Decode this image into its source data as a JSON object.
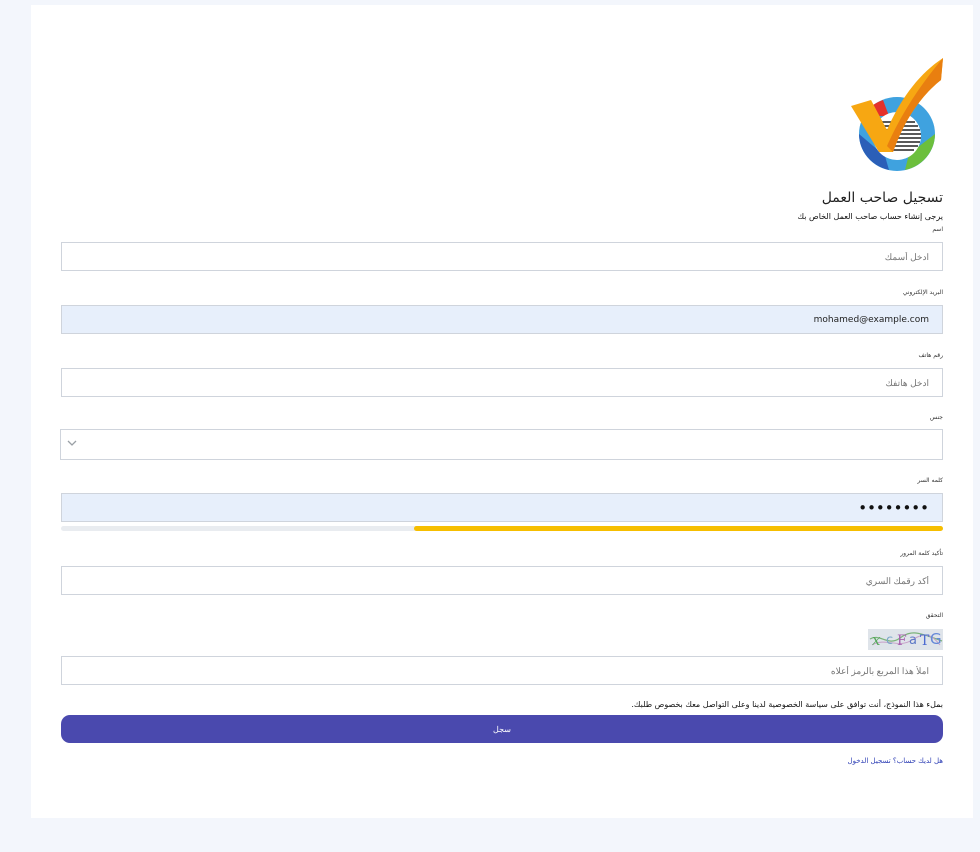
{
  "header": {
    "title": "تسجيل صاحب العمل",
    "subtitle": "يرجى إنشاء حساب صاحب العمل الخاص بك"
  },
  "fields": {
    "name": {
      "label": "اسم",
      "placeholder": "ادخل أسمك",
      "value": ""
    },
    "email": {
      "label": "البريد الإلكتروني",
      "placeholder": "",
      "value": "mohamed@example.com"
    },
    "phone": {
      "label": "رقم هاتف",
      "placeholder": "ادخل هاتفك",
      "value": ""
    },
    "gender": {
      "label": "جنس",
      "value": ""
    },
    "password": {
      "label": "كلمه السر",
      "value": "••••••••",
      "strength": 0.6
    },
    "confirm_password": {
      "label": "تأكيد كلمة المرور",
      "placeholder": "أكد رقمك السري",
      "value": ""
    },
    "captcha": {
      "label": "التحقق",
      "placeholder": "املأ هذا المربع بالرمز أعلاه",
      "value": ""
    }
  },
  "consent_text": "بملء هذا النموذج، أنت توافق على سياسة الخصوصية لدينا وعلى التواصل معك بخصوص طلبك.",
  "submit_label": "سجل",
  "login_link": "هل لديك حساب؟ تسجيل الدخول",
  "colors": {
    "page_bg": "#f3f6fc",
    "primary": "#4a49ae",
    "strength": "#f6be00",
    "filled_bg": "#e7effb"
  }
}
